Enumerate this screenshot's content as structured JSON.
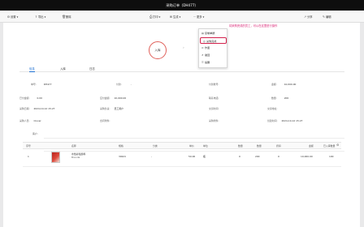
{
  "window": {
    "title": "采购订单（DH477）"
  },
  "toolbar": {
    "left": [
      {
        "icon": "gear-icon",
        "label": "设置",
        "dropdown": true
      },
      {
        "icon": "export-icon",
        "label": "导出",
        "dropdown": true
      },
      {
        "icon": "trash-icon",
        "label": "删除"
      }
    ],
    "center": [
      {
        "icon": "print-icon",
        "label": "打印",
        "dropdown": true
      },
      {
        "icon": "generate-icon",
        "label": "生成",
        "dropdown": true
      },
      {
        "icon": "more-icon",
        "label": "更多",
        "dropdown": true
      }
    ],
    "right": [
      {
        "icon": "share-icon",
        "label": "分享"
      },
      {
        "icon": "edit-icon",
        "label": "编辑"
      }
    ]
  },
  "more_menu": {
    "items": [
      {
        "icon": "doc-icon",
        "label": "复制单据"
      },
      {
        "icon": "check-circle-icon",
        "label": "采购完成",
        "highlighted": true
      },
      {
        "icon": "archive-icon",
        "label": "作废"
      },
      {
        "icon": "return-icon",
        "label": "撤回"
      },
      {
        "icon": "note-icon",
        "label": "提醒"
      }
    ]
  },
  "callout": {
    "text": "将采购完成的员工，可以在这里进行操作"
  },
  "flow": {
    "node_label": "入库"
  },
  "tabs": [
    {
      "label": "信息",
      "active": true
    },
    {
      "label": "入库",
      "active": false
    },
    {
      "label": "日志",
      "active": false
    }
  ],
  "fields": [
    {
      "label": "单号:",
      "value": "DH477"
    },
    {
      "label": "付款:",
      "value": "-"
    },
    {
      "label": "付款账号:",
      "value": ""
    },
    {
      "label": "金额:",
      "value": "10,000.00"
    },
    {
      "label": "已付金额:",
      "value": "0.00"
    },
    {
      "label": "应付金额:",
      "value": "10,000.00"
    },
    {
      "label": "联系电话:",
      "value": ""
    },
    {
      "label": "数量:",
      "value": "200"
    },
    {
      "label": "采购日期:",
      "value": "2024-10-12 15:27"
    },
    {
      "label": "采购负责:",
      "value": "员工用户"
    },
    {
      "label": "交货时间:",
      "value": ""
    },
    {
      "label": "交货地址:",
      "value": ""
    },
    {
      "label": "采购人员:",
      "value": "Clover"
    },
    {
      "label": "合同附件:",
      "value": ""
    },
    {
      "label": "采购附件:",
      "value": ""
    },
    {
      "label": "创建时间:",
      "value": "2024-10-12 15:27"
    },
    {
      "label": "客户:",
      "value": ""
    },
    {
      "label": "备注:",
      "value": ""
    }
  ],
  "table": {
    "headers": [
      "序号",
      "名称",
      "规格",
      "分类",
      "单价",
      "单位",
      "数量",
      "数量",
      "折扣",
      "金额",
      "已入库数量"
    ],
    "rows": [
      {
        "index": "1",
        "name_line1": "水性彩绘颜料",
        "name_line2": "Brenda",
        "spec": "300ml",
        "category": "-",
        "price": "50.00",
        "unit": "瓶",
        "qty1": "0",
        "qty2": "200",
        "discount": "0",
        "amount": "10,000.00",
        "received": "100"
      }
    ]
  },
  "colors": {
    "accent": "#1b6fd1",
    "callout": "#d9196e",
    "titlebar": "#0e0e0e",
    "flow_node": "#e0605a"
  }
}
